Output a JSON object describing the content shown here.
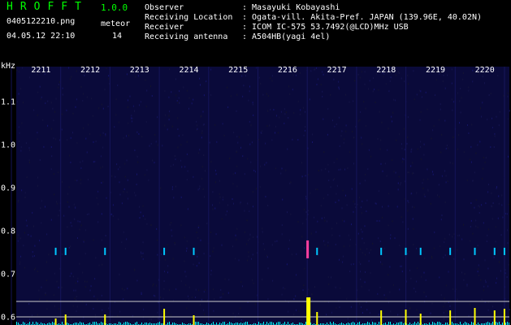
{
  "app": {
    "title": "HROFFT",
    "version": "1.0.0"
  },
  "file": {
    "name": "0405122210.png",
    "datetime": "04.05.12 22:10"
  },
  "meteor": {
    "label": "meteor",
    "count": "14"
  },
  "info": [
    {
      "key": "Observer",
      "value": ": Masayuki Kobayashi"
    },
    {
      "key": "Receiving Location",
      "value": ": Ogata-vill. Akita-Pref. JAPAN (139.96E, 40.02N)"
    },
    {
      "key": "Receiver",
      "value": ": ICOM IC-575 53.7492(@LCD)MHz USB"
    },
    {
      "key": "Receiving antenna",
      "value": ": A504HB(yagi 4el)"
    }
  ],
  "chart_data": {
    "type": "heatmap",
    "y_unit": "kHz",
    "x_ticks": [
      "2211",
      "2212",
      "2213",
      "2214",
      "2215",
      "2216",
      "2217",
      "2218",
      "2219",
      "2220"
    ],
    "y_ticks": [
      "1.1",
      "1.0",
      "0.9",
      "0.8",
      "0.7",
      "0.6"
    ],
    "ylim": [
      0.58,
      1.18
    ],
    "meteor_echo_time_frac": [
      0.08,
      0.1,
      0.18,
      0.3,
      0.36,
      0.59,
      0.61,
      0.74,
      0.79,
      0.82,
      0.88,
      0.93,
      0.97,
      0.99
    ],
    "signal_band_khz": 0.75,
    "colors": {
      "background": "#000000",
      "spectrum": "#0a0a3a",
      "echo": "#00c8ff",
      "strong_echo": "#ff3fa0",
      "trace": "#ffff00",
      "noise": "#00ffff",
      "axis_text": "#ffffff",
      "title": "#00ff00"
    }
  }
}
